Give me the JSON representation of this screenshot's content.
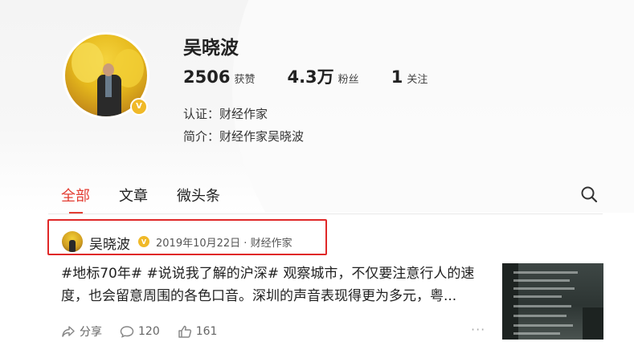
{
  "profile": {
    "name": "吴晓波",
    "stats": [
      {
        "value": "2506",
        "label": "获赞"
      },
      {
        "value": "4.3万",
        "label": "粉丝"
      },
      {
        "value": "1",
        "label": "关注"
      }
    ],
    "certification": "认证：财经作家",
    "bio": "简介：财经作家吴晓波",
    "verified_mark": "V"
  },
  "tabs": [
    {
      "label": "全部",
      "active": true
    },
    {
      "label": "文章",
      "active": false
    },
    {
      "label": "微头条",
      "active": false
    }
  ],
  "post": {
    "author": "吴晓波",
    "meta": "2019年10月22日 · 财经作家",
    "text": "#地标70年# #说说我了解的沪深# 观察城市，不仅要注意行人的速度，也会留意周围的各色口音。深圳的声音表现得更为多元，粤...",
    "actions": {
      "share": "分享",
      "comments": "120",
      "likes": "161"
    },
    "more": "···"
  },
  "colors": {
    "accent": "#e33e33",
    "highlight_box": "#e02828",
    "verify": "#f0b928"
  }
}
